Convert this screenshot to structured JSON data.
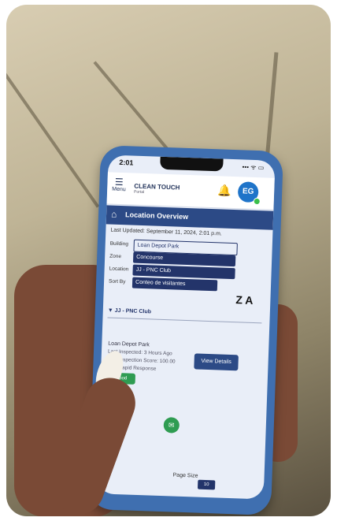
{
  "status_bar": {
    "time": "2:01",
    "right": "••• ᯤ ▭"
  },
  "header": {
    "menu_label": "Menu",
    "logo": "CLEAN TOUCH",
    "logo_sub": "Portal",
    "avatar_initials": "EG"
  },
  "page": {
    "title": "Location Overview",
    "last_updated": "Last Updated: September 11, 2024, 2:01 p.m."
  },
  "filters": [
    {
      "label": "Building",
      "value": "Loan Depot Park"
    },
    {
      "label": "Zone",
      "value": "Concourse"
    },
    {
      "label": "Location",
      "value": "JJ - PNC Club"
    },
    {
      "label": "Sort By",
      "value": "Conteo de visitantes"
    }
  ],
  "sort_icon": "Z A",
  "group_label": "▼ JJ - PNC Club",
  "card": {
    "title": "Loan Depot Park",
    "lines": [
      "Last Inspected: 3 Hours Ago",
      "Last Inspection Score: 100.00",
      "Last Rapid Response"
    ],
    "view_button": "View Details",
    "green_button": "Good"
  },
  "footer": {
    "page_size_label": "Page Size",
    "page_size_value": "10"
  },
  "icons": {
    "menu": "hamburger-icon",
    "bell": "bell-icon",
    "home": "home-icon",
    "chat": "chat-icon",
    "sort": "sort-icon"
  }
}
